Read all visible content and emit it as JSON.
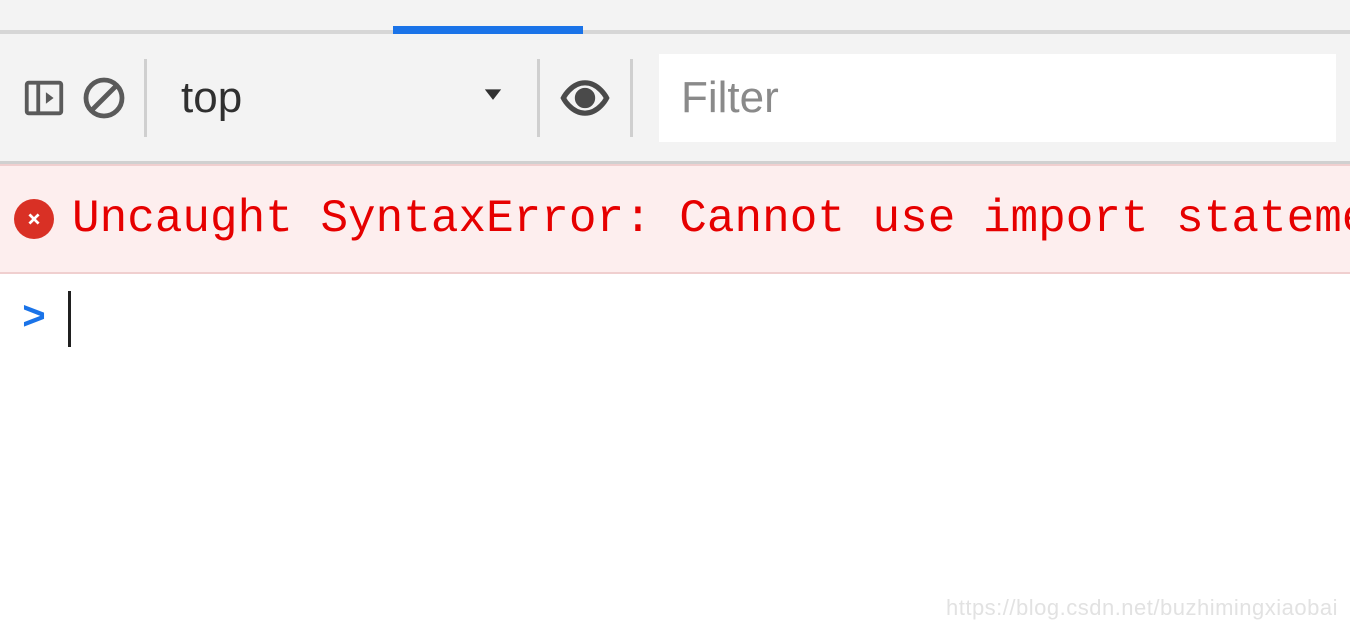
{
  "toolbar": {
    "context_selected": "top",
    "filter_placeholder": "Filter"
  },
  "messages": [
    {
      "level": "error",
      "text": "Uncaught SyntaxError: Cannot use import statement outside a module"
    }
  ],
  "prompt": {
    "caret": ">"
  },
  "watermark": "https://blog.csdn.net/buzhimingxiaobai",
  "icons": {
    "toggle_panel": "toggle-panel-icon",
    "clear": "clear-console-icon",
    "eye": "live-expression-icon",
    "error": "error-icon"
  }
}
